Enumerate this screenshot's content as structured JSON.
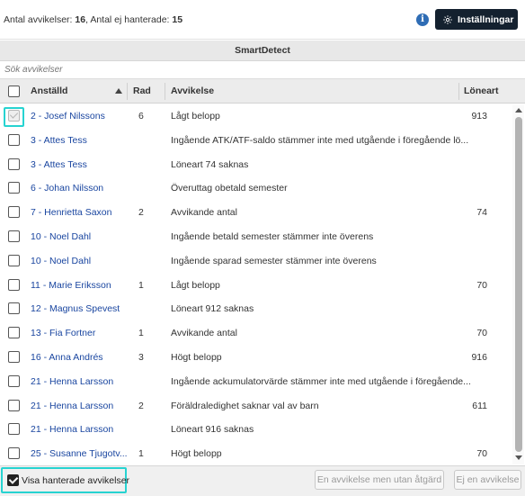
{
  "summary": {
    "deviations_label": "Antal avvikelser:",
    "deviations_count": "16",
    "unhandled_label": ", Antal ej hanterade:",
    "unhandled_count": "15"
  },
  "toolbar": {
    "info_glyph": "i",
    "settings_label": "Inställningar"
  },
  "panel": {
    "title": "SmartDetect",
    "search_placeholder": "Sök avvikelser"
  },
  "table": {
    "columns": {
      "employee": "Anställd",
      "row": "Rad",
      "deviation": "Avvikelse",
      "wage_type": "Löneart"
    },
    "sort": {
      "column": "employee",
      "direction": "ascending"
    },
    "rows": [
      {
        "employee": "2 - Josef Nilssons",
        "row": "6",
        "deviation": "Lågt belopp",
        "wage_type": "913",
        "handled": true
      },
      {
        "employee": "3 - Attes Tess",
        "row": "",
        "deviation": "Ingående ATK/ATF-saldo stämmer inte med utgående i föregående lö...",
        "wage_type": "",
        "handled": false
      },
      {
        "employee": "3 - Attes Tess",
        "row": "",
        "deviation": "Löneart 74 saknas",
        "wage_type": "",
        "handled": false
      },
      {
        "employee": "6 - Johan Nilsson",
        "row": "",
        "deviation": "Överuttag obetald semester",
        "wage_type": "",
        "handled": false
      },
      {
        "employee": "7 - Henrietta Saxon",
        "row": "2",
        "deviation": "Avvikande antal",
        "wage_type": "74",
        "handled": false
      },
      {
        "employee": "10 - Noel Dahl",
        "row": "",
        "deviation": "Ingående betald semester stämmer inte överens",
        "wage_type": "",
        "handled": false
      },
      {
        "employee": "10 - Noel Dahl",
        "row": "",
        "deviation": "Ingående sparad semester stämmer inte överens",
        "wage_type": "",
        "handled": false
      },
      {
        "employee": "11 - Marie Eriksson",
        "row": "1",
        "deviation": "Lågt belopp",
        "wage_type": "70",
        "handled": false
      },
      {
        "employee": "12 - Magnus Spevest",
        "row": "",
        "deviation": "Löneart 912 saknas",
        "wage_type": "",
        "handled": false
      },
      {
        "employee": "13 - Fia Fortner",
        "row": "1",
        "deviation": "Avvikande antal",
        "wage_type": "70",
        "handled": false
      },
      {
        "employee": "16 - Anna Andrés",
        "row": "3",
        "deviation": "Högt belopp",
        "wage_type": "916",
        "handled": false
      },
      {
        "employee": "21 - Henna Larsson",
        "row": "",
        "deviation": "Ingående ackumulatorvärde stämmer inte med utgående i föregående...",
        "wage_type": "",
        "handled": false
      },
      {
        "employee": "21 - Henna Larsson",
        "row": "2",
        "deviation": "Föräldraledighet saknar val av barn",
        "wage_type": "611",
        "handled": false
      },
      {
        "employee": "21 - Henna Larsson",
        "row": "",
        "deviation": "Löneart 916 saknas",
        "wage_type": "",
        "handled": false
      },
      {
        "employee": "25 - Susanne Tjugotv...",
        "row": "1",
        "deviation": "Högt belopp",
        "wage_type": "70",
        "handled": false
      }
    ]
  },
  "footer": {
    "show_handled_label": "Visa hanterade avvikelser",
    "show_handled_checked": true,
    "deviation_without_action_label": "En avvikelse men utan åtgärd",
    "not_deviation_label": "Ej en avvikelse"
  },
  "colors": {
    "accent_focus": "#27d3d1",
    "settings_button_bg": "#14212f",
    "link_text": "#1a46a0",
    "info_icon": "#2f6db5"
  },
  "icons": {
    "info": "info-icon",
    "settings": "gear-icon",
    "sort": "sort-ascending-icon"
  }
}
